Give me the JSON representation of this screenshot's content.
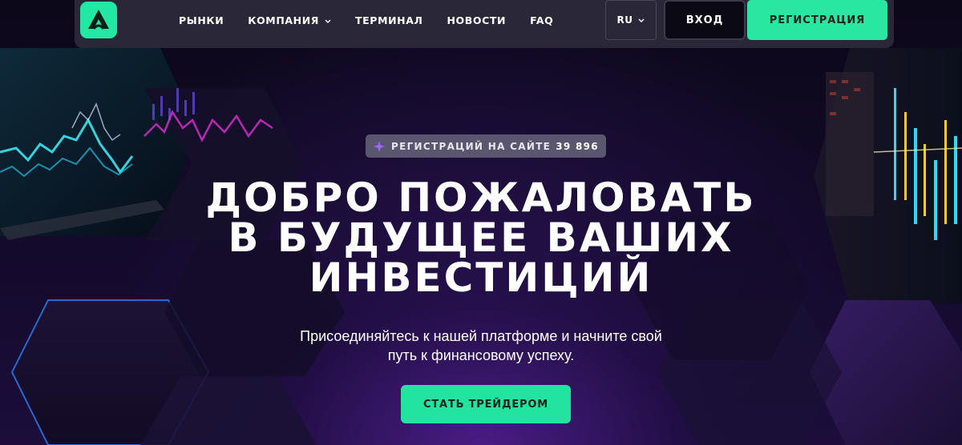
{
  "nav": {
    "logo_letter": "A",
    "items": [
      {
        "label": "РЫНКИ",
        "has_dropdown": false
      },
      {
        "label": "КОМПАНИЯ",
        "has_dropdown": true
      },
      {
        "label": "ТЕРМИНАЛ",
        "has_dropdown": false
      },
      {
        "label": "НОВОСТИ",
        "has_dropdown": false
      },
      {
        "label": "FAQ",
        "has_dropdown": false
      }
    ],
    "language": "RU",
    "login_label": "ВХОД",
    "register_label": "РЕГИСТРАЦИЯ"
  },
  "hero": {
    "badge_label": "РЕГИСТРАЦИЙ НА САЙТЕ",
    "badge_count": "39 896",
    "title_lines": [
      "ДОБРО ПОЖАЛОВАТЬ",
      "В БУДУЩЕЕ ВАШИХ",
      "ИНВЕСТИЦИЙ"
    ],
    "subtitle_lines": [
      "Присоединяйтесь к нашей платформе и начните свой",
      "путь к финансовому успеху."
    ],
    "cta_label": "СТАТЬ ТРЕЙДЕРОМ"
  },
  "colors": {
    "accent": "#22e39f",
    "nav_bg": "#2a2838",
    "page_bg": "#0b0716",
    "badge_bg": "#5a5670",
    "badge_icon": "#9b6bff"
  },
  "icons": {
    "logo": "logo-a-icon",
    "dropdown": "chevron-down-icon",
    "badge": "sparkle-icon"
  }
}
